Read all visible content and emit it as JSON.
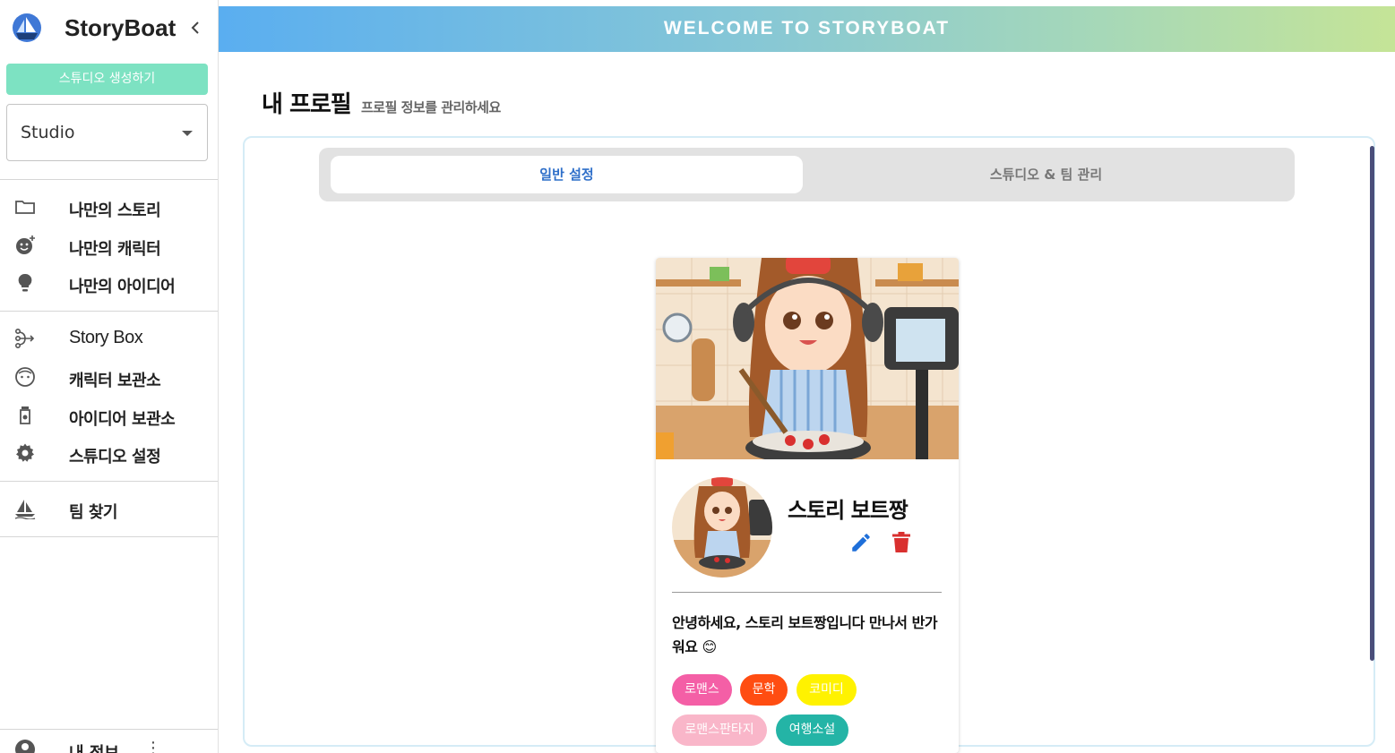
{
  "sidebar": {
    "brand": "StoryBoat",
    "collapse_icon": "chevron-left-icon",
    "create_studio_label": "스튜디오 생성하기",
    "studio_select": {
      "value": "Studio"
    },
    "group1": [
      {
        "label": "나만의 스토리",
        "icon": "folder-icon"
      },
      {
        "label": "나만의 캐릭터",
        "icon": "emoji-add-icon"
      },
      {
        "label": "나만의 아이디어",
        "icon": "lightbulb-icon"
      }
    ],
    "group2": [
      {
        "label": "Story Box",
        "icon": "branch-icon"
      },
      {
        "label": "캐릭터 보관소",
        "icon": "face-icon"
      },
      {
        "label": "아이디어 보관소",
        "icon": "jar-icon"
      },
      {
        "label": "스튜디오 설정",
        "icon": "gear-icon"
      }
    ],
    "group3": [
      {
        "label": "팀 찾기",
        "icon": "sailboat-icon"
      }
    ],
    "my_info": {
      "label": "내 정보",
      "icon": "account-icon"
    }
  },
  "header": {
    "title": "WELCOME TO STORYBOAT"
  },
  "page": {
    "title": "내 프로필",
    "subtitle": "프로필 정보를 관리하세요",
    "tabs": [
      {
        "label": "일반 설정",
        "active": true
      },
      {
        "label": "스튜디오 & 팀 관리",
        "active": false
      }
    ]
  },
  "profile": {
    "nickname": "스토리 보트짱",
    "bio": "안녕하세요, 스토리 보트짱입니다 만나서 반가워요 😊",
    "tags": [
      {
        "label": "로맨스",
        "color": "#f45fa6"
      },
      {
        "label": "문학",
        "color": "#ff4d12"
      },
      {
        "label": "코미디",
        "color": "#fff200"
      },
      {
        "label": "로맨스판타지",
        "color": "#f9b6c9"
      },
      {
        "label": "여행소설",
        "color": "#24b4a6"
      }
    ],
    "colors": {
      "edit": "#1e6fd9",
      "delete": "#d9302f"
    }
  },
  "colors": {
    "accent_button": "#7de2c2",
    "tab_active_text": "#2f6fc9",
    "header_gradient_start": "#5aaef0",
    "header_gradient_end": "#c5e497"
  }
}
